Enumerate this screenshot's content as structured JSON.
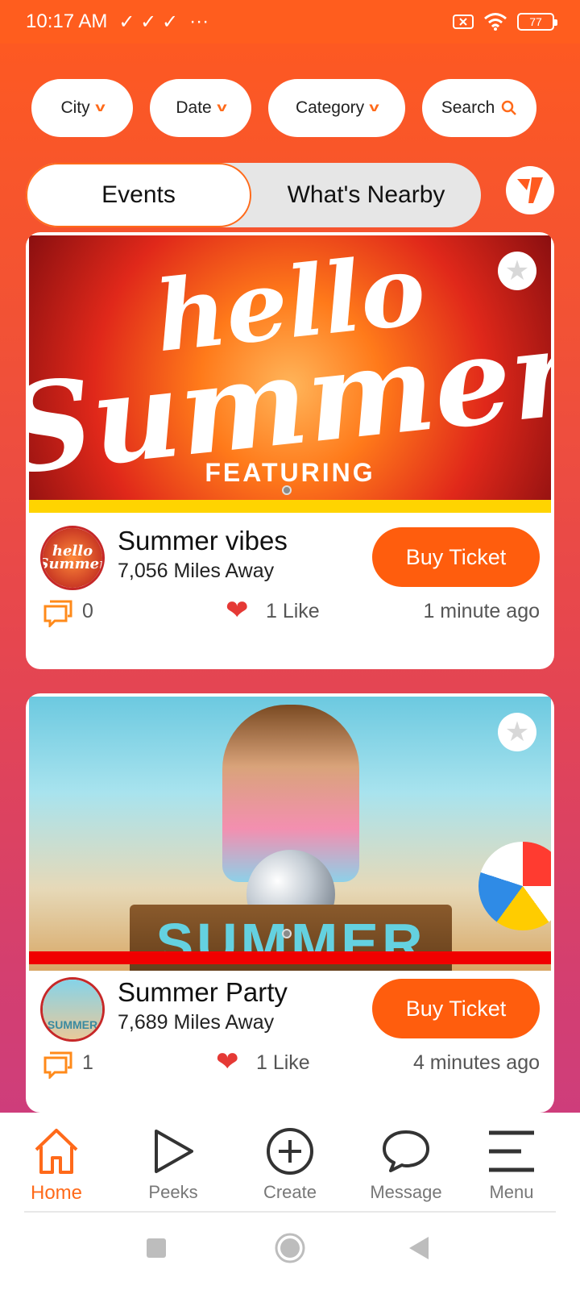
{
  "status_bar": {
    "time": "10:17 AM",
    "notif_icons": "✓ ✓ ✓",
    "more": "···",
    "battery": "77"
  },
  "filters": {
    "city": "City",
    "date": "Date",
    "category": "Category",
    "search": "Search"
  },
  "tabs": {
    "events": "Events",
    "nearby": "What's Nearby"
  },
  "events": [
    {
      "title": "Summer vibes",
      "distance": "7,056 Miles Away",
      "buy_label": "Buy Ticket",
      "comments": "0",
      "likes": "1 Like",
      "time": "1 minute ago",
      "image_text_1": "hello",
      "image_text_2": "Summer",
      "image_text_3": "FEATURING",
      "avatar_text": "hello Summer",
      "bar_color": "#ffd400"
    },
    {
      "title": "Summer Party",
      "distance": "7,689 Miles Away",
      "buy_label": "Buy Ticket",
      "comments": "1",
      "likes": "1 Like",
      "time": "4 minutes ago",
      "image_text": "SUMMER",
      "avatar_text": "SUMMER",
      "bar_color": "#f00000"
    }
  ],
  "bottom_nav": {
    "home": "Home",
    "peeks": "Peeks",
    "create": "Create",
    "message": "Message",
    "menu": "Menu"
  },
  "colors": {
    "accent": "#ff5d0d",
    "like": "#e53935"
  }
}
